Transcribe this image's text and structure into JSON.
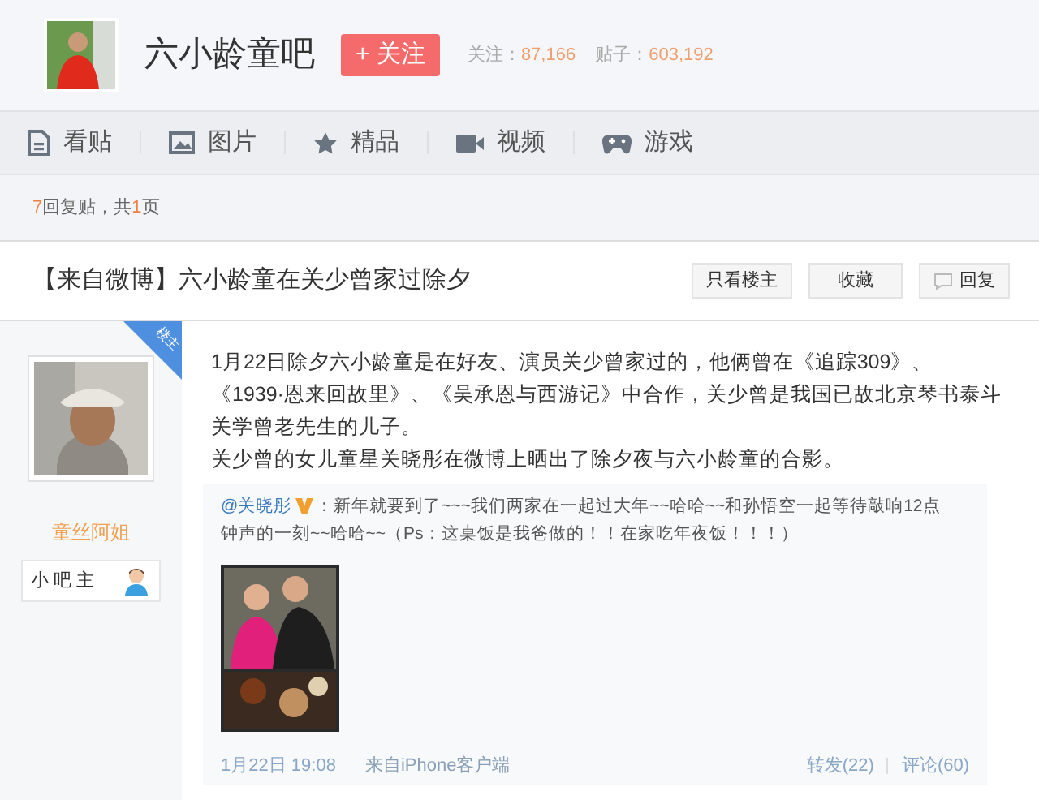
{
  "forum": {
    "name": "六小龄童吧",
    "follow_button": "+ 关注",
    "stats": [
      {
        "label": "关注：",
        "value": "87,166"
      },
      {
        "label": "贴子：",
        "value": "603,192"
      }
    ]
  },
  "nav": [
    {
      "kind": "posts",
      "label": "看贴"
    },
    {
      "kind": "pictures",
      "label": "图片"
    },
    {
      "kind": "featured",
      "label": "精品"
    },
    {
      "kind": "video",
      "label": "视频"
    },
    {
      "kind": "games",
      "label": "游戏"
    }
  ],
  "page_info": {
    "count": "7",
    "text_1": "回复贴，共",
    "pages": "1",
    "text_2": "页"
  },
  "thread": {
    "title": "【来自微博】六小龄童在关少曾家过除夕",
    "actions": [
      {
        "kind": "plain",
        "label": "只看楼主"
      },
      {
        "kind": "plain",
        "label": "收藏"
      },
      {
        "kind": "reply",
        "label": "回复"
      }
    ]
  },
  "post": {
    "author": {
      "badge": "楼主",
      "name": "童丝阿姐",
      "role": "小 吧 主"
    },
    "paragraphs": [
      "1月22日除夕六小龄童是在好友、演员关少曾家过的，他俩曾在《追踪309》、《1939·恩来回故里》、《吴承恩与西游记》中合作，关少曾是我国已故北京琴书泰斗关学曾老先生的儿子。",
      "关少曾的女儿童星关晓彤在微博上晒出了除夕夜与六小龄童的合影。"
    ],
    "weibo": {
      "user": "@关晓彤",
      "verified": true,
      "text": "：新年就要到了~~~我们两家在一起过大年~~哈哈~~和孙悟空一起等待敲响12点钟声的一刻~~哈哈~~（Ps：这桌饭是我爸做的！！在家吃年夜饭！！！）",
      "time": "1月22日 19:08",
      "source": "来自iPhone客户端",
      "repost": "转发(22)",
      "comment": "评论(60)"
    }
  }
}
